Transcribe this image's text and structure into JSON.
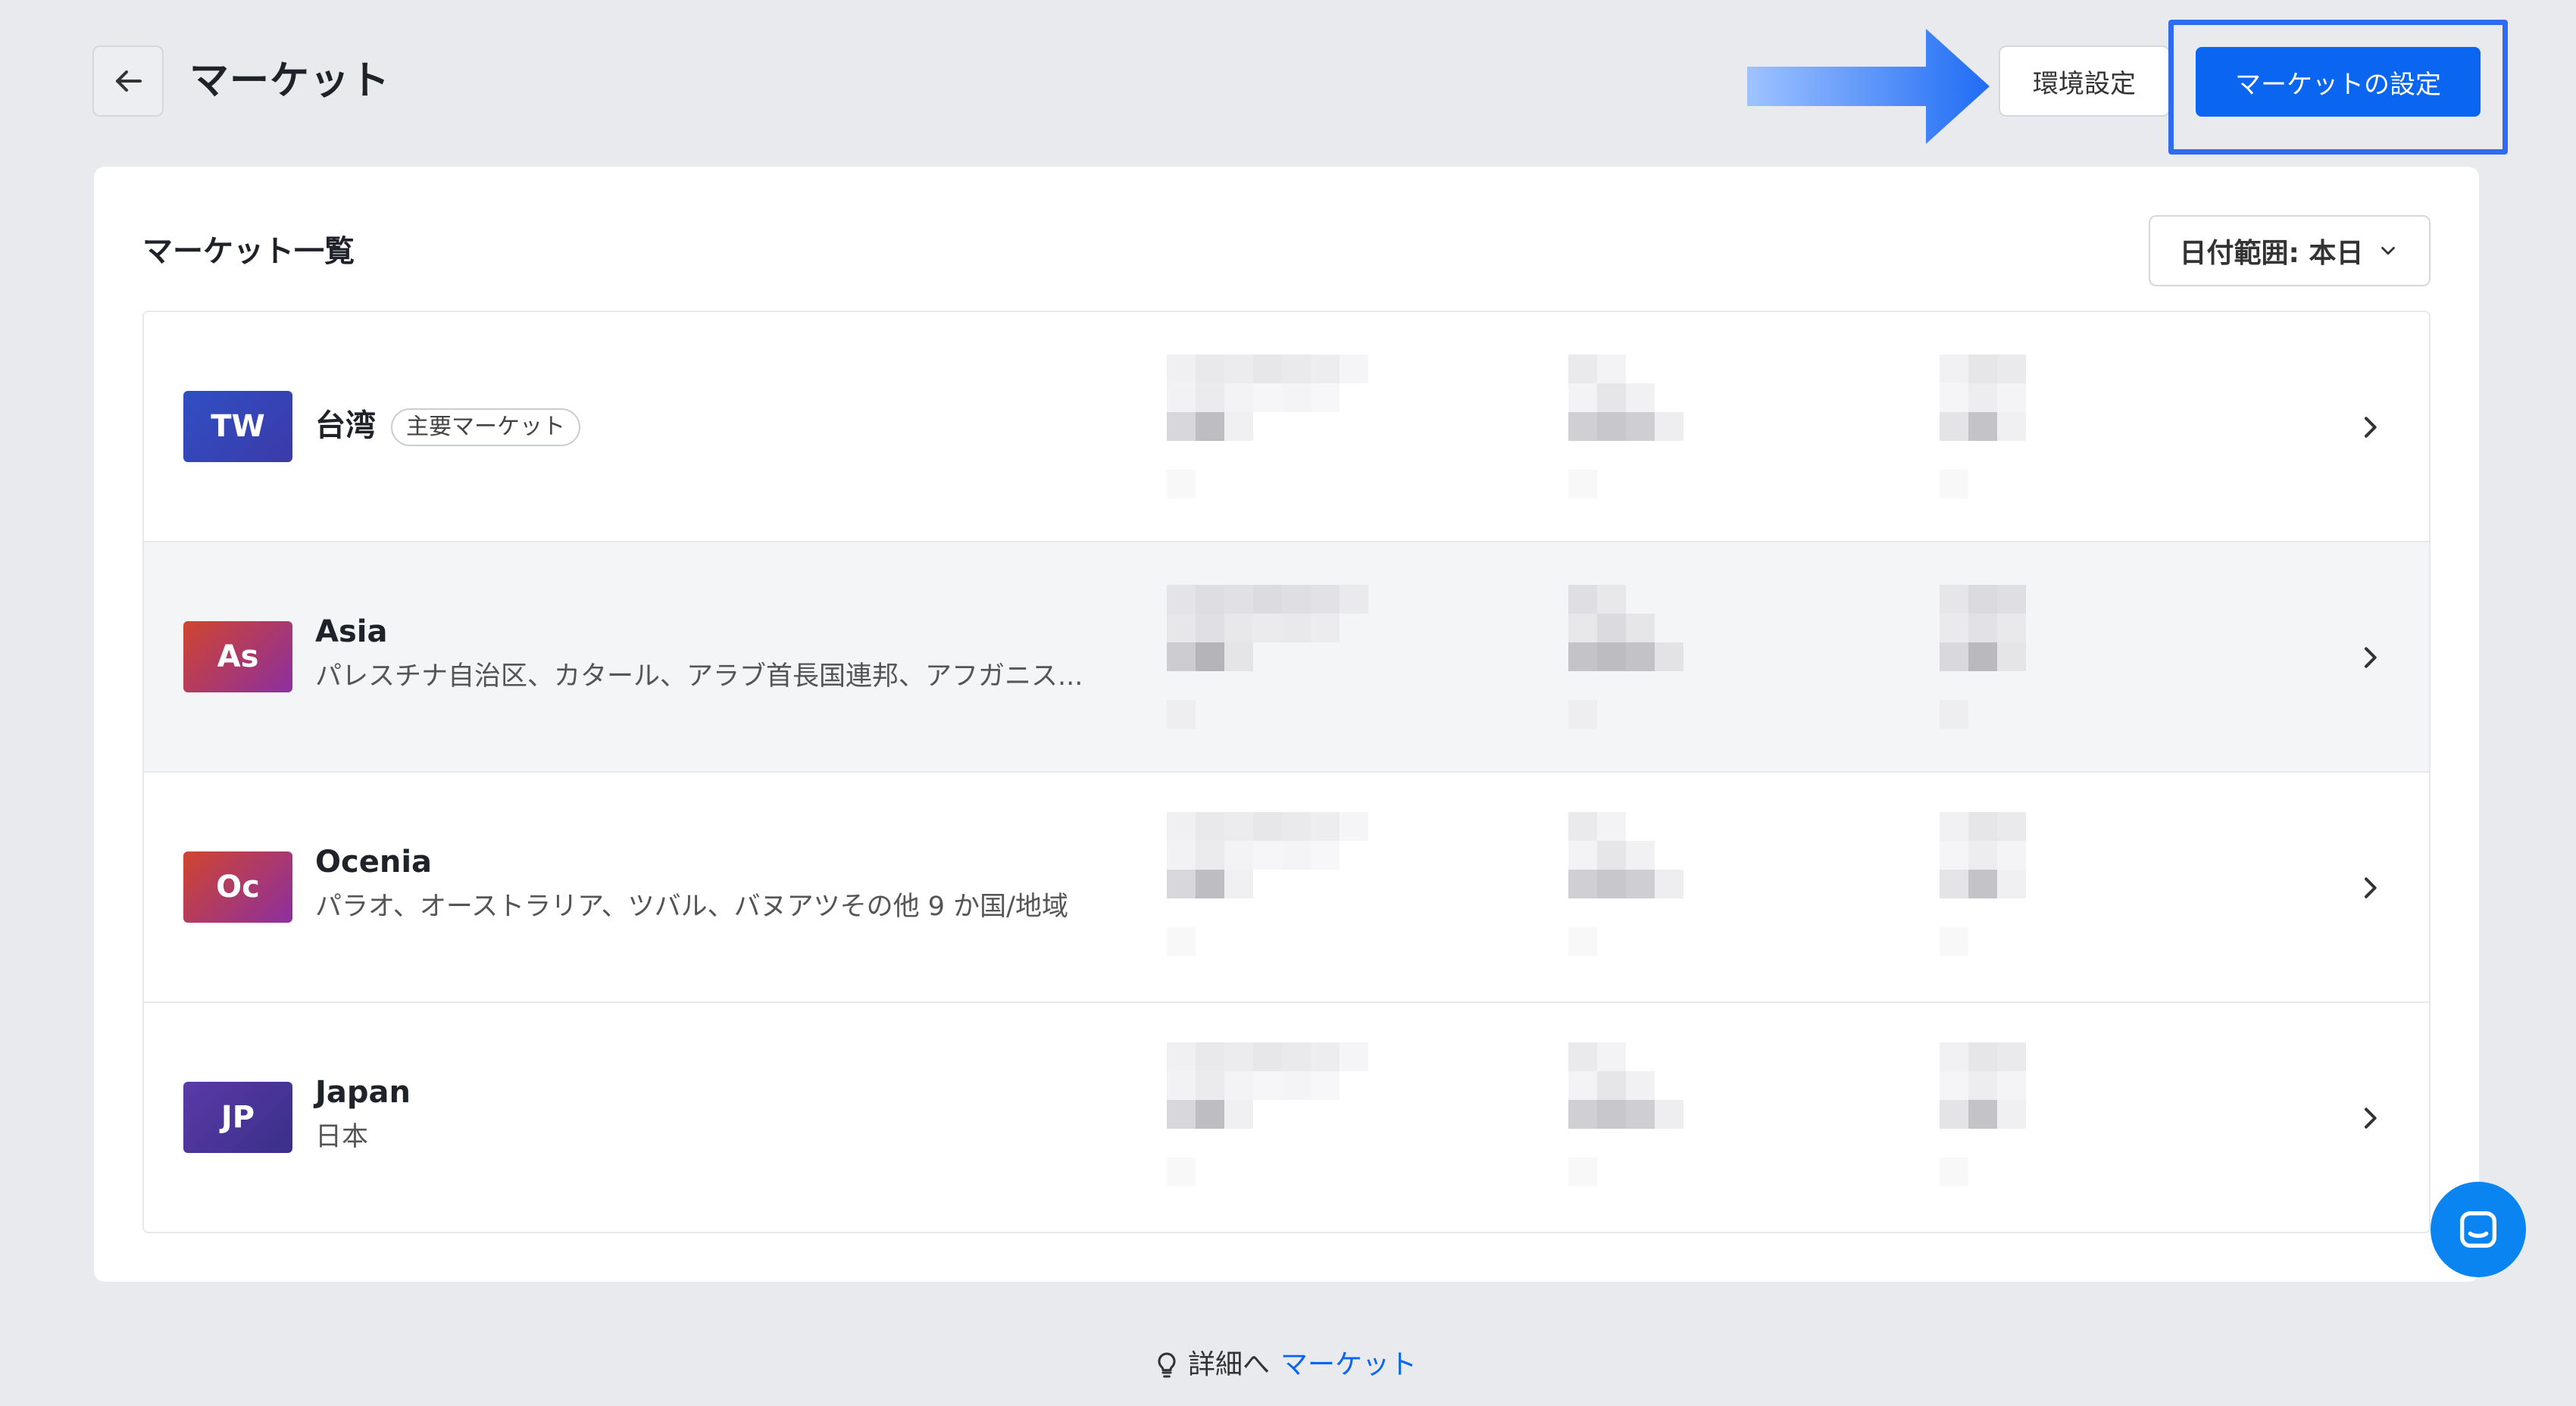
{
  "header": {
    "title": "マーケット",
    "env_button": "環境設定",
    "primary_button": "マーケットの設定"
  },
  "card": {
    "title": "マーケット一覧",
    "date_filter": "日付範囲: 本日"
  },
  "markets": [
    {
      "code": "TW",
      "name": "台湾",
      "tag": "主要マーケット",
      "sub": "",
      "badge_color": "#2f4fc4"
    },
    {
      "code": "As",
      "name": "Asia",
      "tag": "",
      "sub": "パレスチナ自治区、カタール、アラブ首長国連邦、アフガニス...",
      "badge_color": "#c03a4a"
    },
    {
      "code": "Oc",
      "name": "Ocenia",
      "tag": "",
      "sub": "パラオ、オーストラリア、ツバル、バヌアツその他 9 か国/地域",
      "badge_color": "#c0374a"
    },
    {
      "code": "JP",
      "name": "Japan",
      "tag": "",
      "sub": "日本",
      "badge_color": "#4a3a9a"
    }
  ],
  "footer": {
    "prefix": "詳細へ",
    "link": "マーケット"
  },
  "colors": {
    "primary": "#0a66f0",
    "highlight": "#2f6bf0",
    "background": "#e8eaee"
  }
}
